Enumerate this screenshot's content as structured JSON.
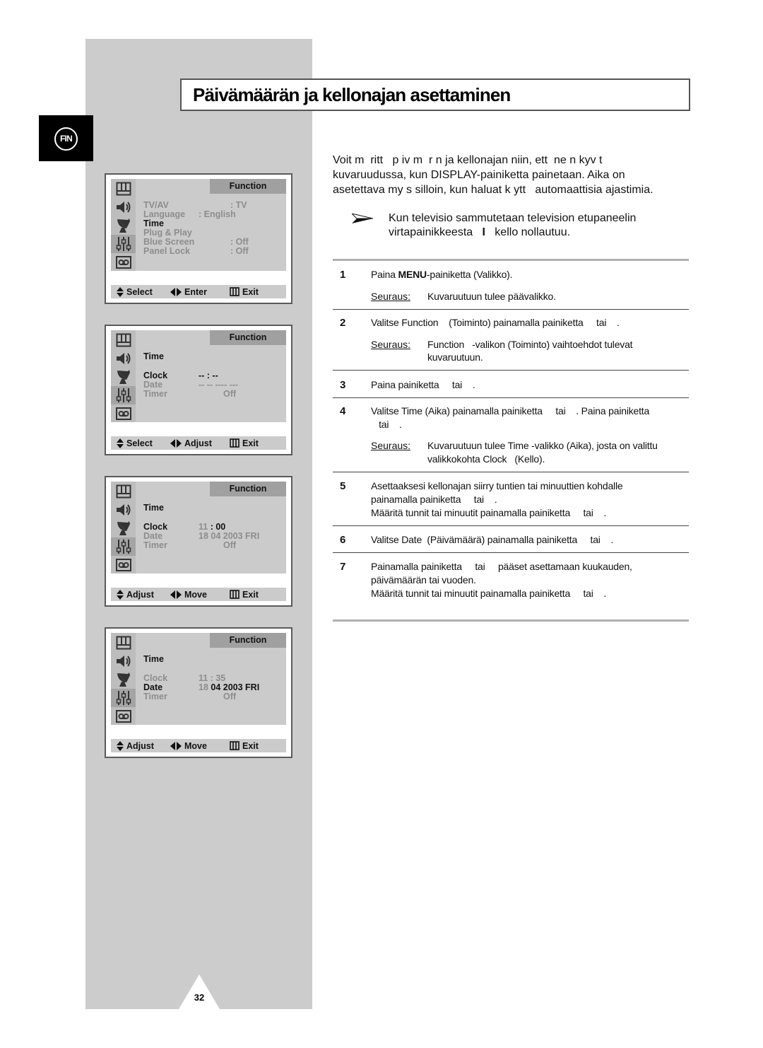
{
  "language_badge": "FIN",
  "title": "Päivämäärän ja kellonajan asettaminen",
  "page_number": "32",
  "intro": [
    "Voit m  ritt   p iv m  r n ja kellonajan niin, ett  ne n kyv t",
    "kuvaruudussa, kun DISPLAY-painiketta painetaan. Aika on",
    "asetettava my s silloin, kun haluat k ytt   automaattisia ajastimia."
  ],
  "note": {
    "icon": "arrow-right",
    "line1": "Kun televisio sammutetaan television etupaneelin",
    "line2_before": "virtapainikkeesta   ",
    "line2_key": "I",
    "line2_after": "   kello nollautuu."
  },
  "result_label": "Seuraus:",
  "steps": [
    {
      "number": "1",
      "line_before": "Paina ",
      "line_key": "MENU",
      "line_after": "-painiketta (Valikko).",
      "result": [
        "Kuvaruutuun tulee päävalikko."
      ]
    },
    {
      "number": "2",
      "lines": [
        "Valitse Function    (Toiminto) painamalla painiketta     tai    ."
      ],
      "result": [
        "Function   -valikon (Toiminto) vaihtoehdot tulevat",
        "kuvaruutuun."
      ]
    },
    {
      "number": "3",
      "lines": [
        "Paina painiketta     tai    ."
      ]
    },
    {
      "number": "4",
      "lines": [
        "Valitse Time (Aika) painamalla painiketta     tai    . Paina painiketta",
        "   tai    ."
      ],
      "result": [
        "Kuvaruutuun tulee Time -valikko (Aika), josta on valittu",
        "valikkokohta Clock   (Kello)."
      ]
    },
    {
      "number": "5",
      "lines": [
        "Asettaaksesi kellonajan siirry tuntien tai minuuttien kohdalle",
        "painamalla painiketta     tai    .",
        "Määritä tunnit tai minuutit painamalla painiketta     tai    ."
      ]
    },
    {
      "number": "6",
      "lines": [
        "Valitse Date  (Päivämäärä) painamalla painiketta     tai    ."
      ]
    },
    {
      "number": "7",
      "lines": [
        "Painamalla painiketta     tai     pääset asettamaan kuukauden,",
        "päivämäärän tai vuoden.",
        "Määritä tunnit tai minuutit painamalla painiketta     tai    ."
      ]
    }
  ],
  "menu_icons": [
    "picture-icon",
    "sound-icon",
    "channel-icon",
    "function-icon",
    "input-icon"
  ],
  "menus": [
    {
      "header": "Function",
      "items": [
        {
          "label": "TV/AV",
          "value": ": TV"
        },
        {
          "label": "Language",
          "value": ": English"
        },
        {
          "label": "Time"
        },
        {
          "label": "Plug & Play"
        },
        {
          "label": "Blue Screen",
          "value": ": Off"
        },
        {
          "label": "Panel Lock",
          "value": ": Off"
        }
      ],
      "footer": [
        "Select",
        "Enter",
        "Exit"
      ]
    },
    {
      "header": "Function",
      "title": "Time",
      "items": [
        {
          "label": "Clock",
          "value": "-- : --"
        },
        {
          "label": "Date",
          "value": "-- -- ---- ---"
        },
        {
          "label": "Timer",
          "value": "Off"
        }
      ],
      "footer": [
        "Select",
        "Adjust",
        "Exit"
      ]
    },
    {
      "header": "Function",
      "title": "Time",
      "items": [
        {
          "label": "Clock",
          "value_dim": "11",
          "value": " : 00"
        },
        {
          "label": "Date",
          "value": "18 04 2003 FRI"
        },
        {
          "label": "Timer",
          "value": "Off"
        }
      ],
      "footer": [
        "Adjust",
        "Move",
        "Exit"
      ]
    },
    {
      "header": "Function",
      "title": "Time",
      "items": [
        {
          "label": "Clock",
          "value": "11 : 35"
        },
        {
          "label": "Date",
          "value_dim": "18",
          "value": " 04 2003 FRI"
        },
        {
          "label": "Timer",
          "value": "Off"
        }
      ],
      "footer": [
        "Adjust",
        "Move",
        "Exit"
      ]
    }
  ]
}
